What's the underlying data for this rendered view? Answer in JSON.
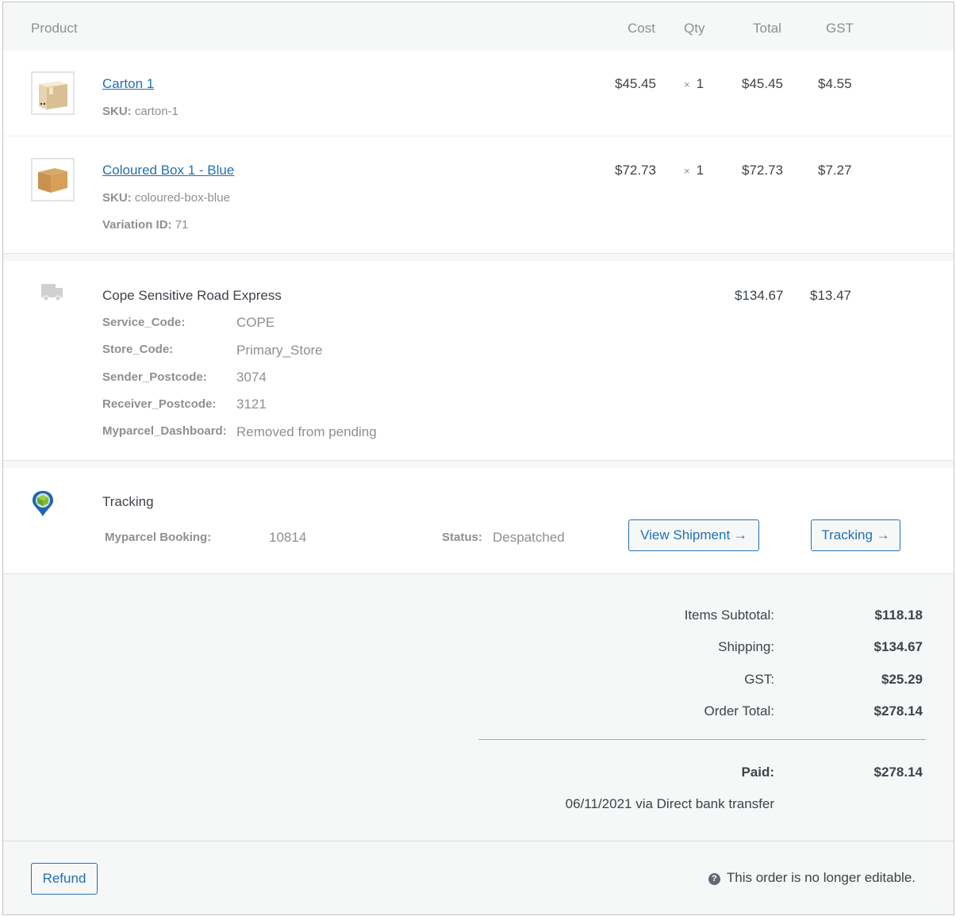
{
  "header": {
    "product": "Product",
    "cost": "Cost",
    "qty": "Qty",
    "total": "Total",
    "gst": "GST"
  },
  "items": [
    {
      "name": "Carton 1",
      "thumbnail_icon": "carton-box-icon",
      "sku_label": "SKU:",
      "sku": "carton-1",
      "cost": "$45.45",
      "qty_prefix": "×",
      "qty": "1",
      "total": "$45.45",
      "gst": "$4.55"
    },
    {
      "name": "Coloured Box 1 - Blue",
      "thumbnail_icon": "cardboard-box-icon",
      "sku_label": "SKU:",
      "sku": "coloured-box-blue",
      "variation_label": "Variation ID:",
      "variation_id": "71",
      "cost": "$72.73",
      "qty_prefix": "×",
      "qty": "1",
      "total": "$72.73",
      "gst": "$7.27"
    }
  ],
  "shipping": {
    "icon": "truck-icon",
    "title": "Cope Sensitive Road Express",
    "total": "$134.67",
    "gst": "$13.47",
    "meta": [
      {
        "label": "Service_Code:",
        "value": "COPE"
      },
      {
        "label": "Store_Code:",
        "value": "Primary_Store"
      },
      {
        "label": "Sender_Postcode:",
        "value": "3074"
      },
      {
        "label": "Receiver_Postcode:",
        "value": "3121"
      },
      {
        "label": "Myparcel_Dashboard:",
        "value": "Removed from pending"
      }
    ]
  },
  "tracking": {
    "icon": "map-pin-parcel-icon",
    "title": "Tracking",
    "booking_label": "Myparcel Booking:",
    "booking_value": "10814",
    "status_label": "Status:",
    "status_value": "Despatched",
    "view_shipment_button": "View Shipment →",
    "tracking_button": "Tracking →"
  },
  "totals": {
    "items_subtotal_label": "Items Subtotal:",
    "items_subtotal": "$118.18",
    "shipping_label": "Shipping:",
    "shipping": "$134.67",
    "gst_label": "GST:",
    "gst": "$25.29",
    "order_total_label": "Order Total:",
    "order_total": "$278.14",
    "paid_label": "Paid:",
    "paid": "$278.14",
    "paid_note": "06/11/2021 via Direct bank transfer"
  },
  "footer": {
    "refund_button": "Refund",
    "help_icon": "help-icon",
    "help_text": "This order is no longer editable."
  },
  "colors": {
    "link": "#2271b1",
    "muted": "#8c8f94",
    "text": "#3c434a",
    "panel_bg": "#f6f7f7"
  }
}
